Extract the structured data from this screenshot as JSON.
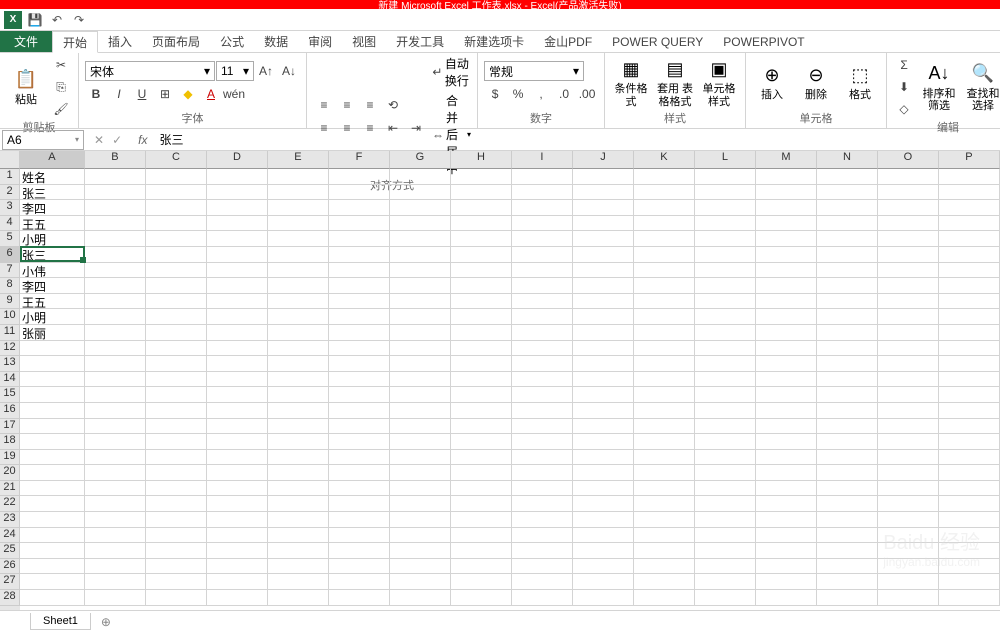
{
  "title_bar": "新建 Microsoft Excel 工作表.xlsx - Excel(产品激活失败)",
  "tabs": {
    "file": "文件",
    "items": [
      "开始",
      "插入",
      "页面布局",
      "公式",
      "数据",
      "审阅",
      "视图",
      "开发工具",
      "新建选项卡",
      "金山PDF",
      "POWER QUERY",
      "POWERPIVOT"
    ],
    "active": "开始"
  },
  "ribbon": {
    "clipboard": {
      "paste": "粘贴",
      "label": "剪贴板"
    },
    "font": {
      "name": "宋体",
      "size": "11",
      "label": "字体"
    },
    "align": {
      "wrap": "自动换行",
      "merge": "合并后居中",
      "label": "对齐方式"
    },
    "number": {
      "format": "常规",
      "label": "数字"
    },
    "style": {
      "cond": "条件格式",
      "table": "套用\n表格格式",
      "cell": "单元格样式",
      "label": "样式"
    },
    "cells": {
      "insert": "插入",
      "delete": "删除",
      "format": "格式",
      "label": "单元格"
    },
    "edit": {
      "sort": "排序和筛选",
      "find": "查找和选择",
      "label": "编辑"
    }
  },
  "namebox": "A6",
  "formula": "张三",
  "columns": [
    "A",
    "B",
    "C",
    "D",
    "E",
    "F",
    "G",
    "H",
    "I",
    "J",
    "K",
    "L",
    "M",
    "N",
    "O",
    "P"
  ],
  "rows_count": 28,
  "active": {
    "row": 6,
    "col": 1
  },
  "data": {
    "1": {
      "A": "姓名"
    },
    "2": {
      "A": "张三"
    },
    "3": {
      "A": "李四"
    },
    "4": {
      "A": "王五"
    },
    "5": {
      "A": "小明"
    },
    "6": {
      "A": "张三"
    },
    "7": {
      "A": "小伟"
    },
    "8": {
      "A": "李四"
    },
    "9": {
      "A": "王五"
    },
    "10": {
      "A": "小明"
    },
    "11": {
      "A": "张丽"
    }
  },
  "sheet_tab": "Sheet1",
  "watermark": {
    "brand": "Baidu 经验",
    "url": "jingyan.baidu.com"
  }
}
